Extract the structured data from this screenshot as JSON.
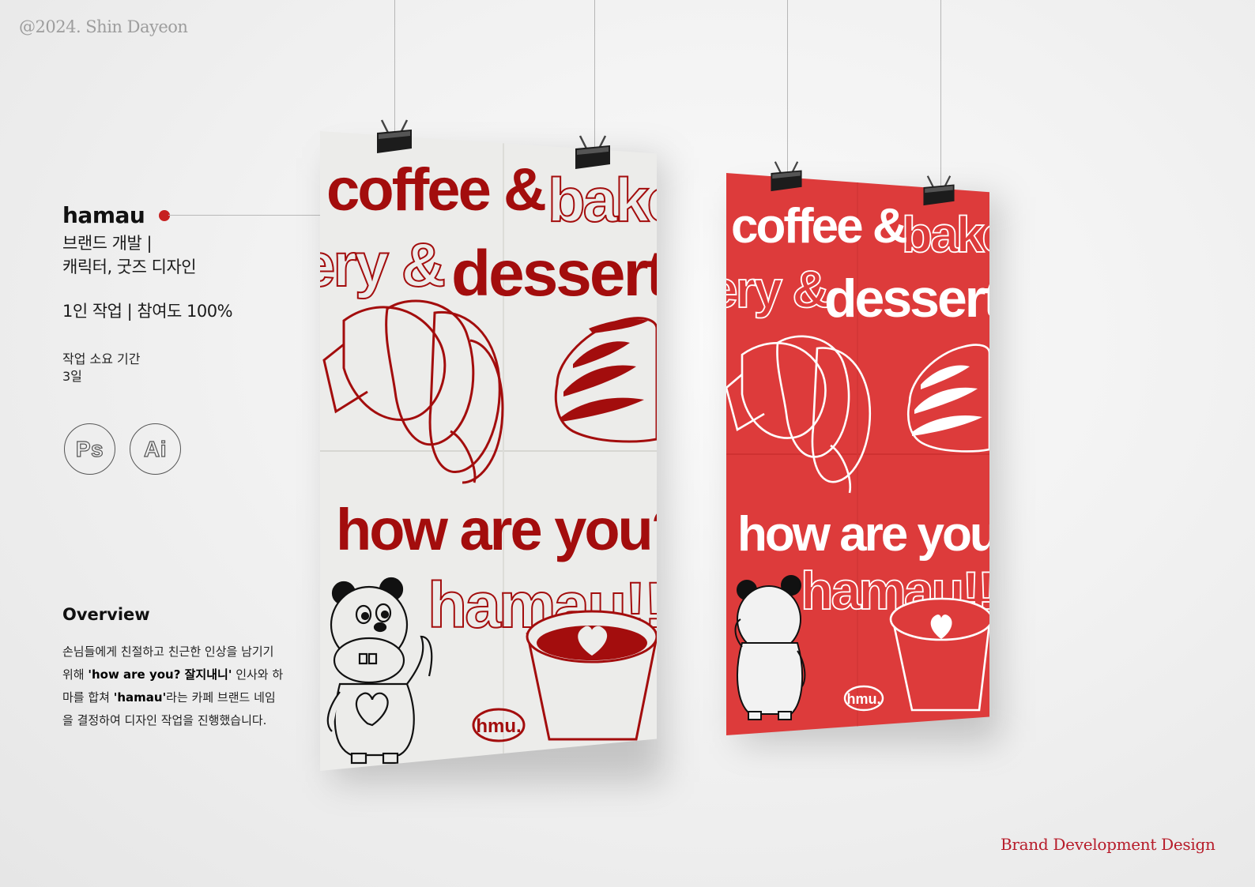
{
  "copyright": "@2024. Shin Dayeon",
  "project": {
    "name": "hamau",
    "role_lines": [
      "브랜드 개발  |",
      "캐릭터, 굿즈 디자인"
    ],
    "participation": "1인 작업  |  참여도 100%",
    "period_label": "작업 소요 기간",
    "period_value": "3일"
  },
  "tools": [
    {
      "label": "Ps",
      "icon": "photoshop-icon"
    },
    {
      "label": "Ai",
      "icon": "illustrator-icon"
    }
  ],
  "overview": {
    "title": "Overview",
    "text_1": "손님들에게 친절하고 친근한 인상을 남기기 위해 ",
    "bold_1": "'how are you? 잘지내니'",
    "text_2": " 인사와 하마를 합쳐 ",
    "bold_2": "'hamau'",
    "text_3": "라는 카페 브랜드 네임을 결정하여 디자인 작업을 진행했습니다."
  },
  "signature": "Brand Development Design",
  "posters": {
    "line_1_solid": "coffee &",
    "line_1_outline": "bake",
    "line_2_outline": "ery &",
    "line_2_solid": "dessert",
    "greeting": "how are you?",
    "brand": "hamau!!",
    "logo": "hmu."
  },
  "colors": {
    "brand_red": "#a30d0d",
    "poster_red": "#dd3b3b",
    "accent": "#c62121",
    "signature": "#b71c2a"
  }
}
